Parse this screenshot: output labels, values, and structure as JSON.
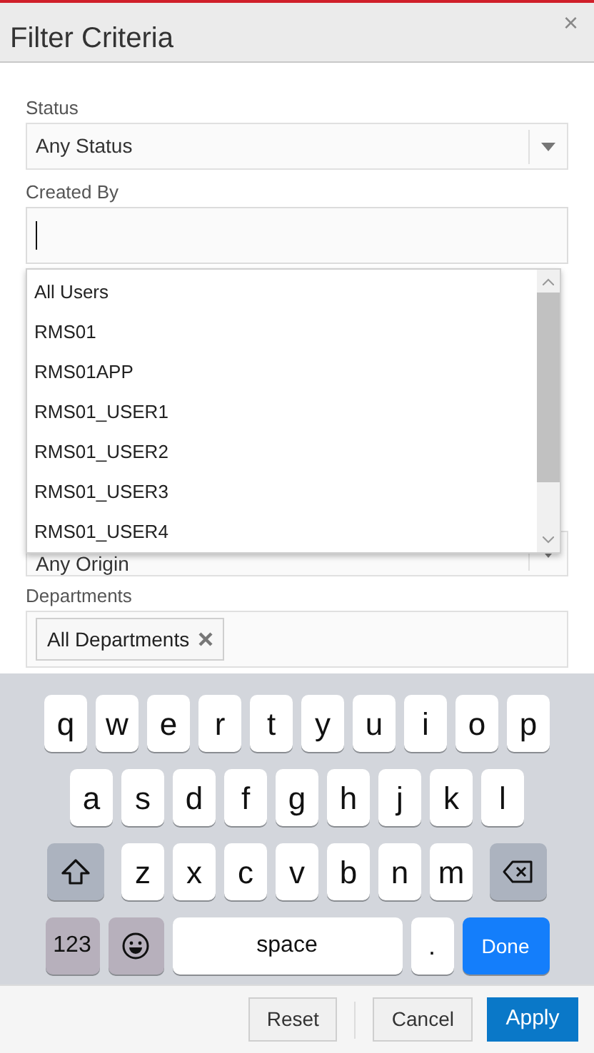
{
  "dialog": {
    "title": "Filter Criteria",
    "close": "×"
  },
  "fields": [
    {
      "kind": "select",
      "label": "Status",
      "value": "Any Status"
    },
    {
      "kind": "text",
      "label": "Created By",
      "focused": true
    },
    {
      "kind": "select",
      "value": "Any Origin"
    },
    {
      "kind": "chips",
      "label": "Departments",
      "chips": [
        "All Departments"
      ]
    }
  ],
  "dropdown": {
    "items": [
      "All Users",
      "RMS01",
      "RMS01APP",
      "RMS01_USER1",
      "RMS01_USER2",
      "RMS01_USER3",
      "RMS01_USER4"
    ]
  },
  "keyboard": {
    "rows": [
      {
        "keys": [
          {
            "kind": "letter",
            "label": "q"
          },
          {
            "kind": "letter",
            "label": "w"
          },
          {
            "kind": "letter",
            "label": "e"
          },
          {
            "kind": "letter",
            "label": "r"
          },
          {
            "kind": "letter",
            "label": "t"
          },
          {
            "kind": "letter",
            "label": "y"
          },
          {
            "kind": "letter",
            "label": "u"
          },
          {
            "kind": "letter",
            "label": "i"
          },
          {
            "kind": "letter",
            "label": "o"
          },
          {
            "kind": "letter",
            "label": "p"
          }
        ]
      },
      {
        "keys": [
          {
            "kind": "letter",
            "label": "a"
          },
          {
            "kind": "letter",
            "label": "s"
          },
          {
            "kind": "letter",
            "label": "d"
          },
          {
            "kind": "letter",
            "label": "f"
          },
          {
            "kind": "letter",
            "label": "g"
          },
          {
            "kind": "letter",
            "label": "h"
          },
          {
            "kind": "letter",
            "label": "j"
          },
          {
            "kind": "letter",
            "label": "k"
          },
          {
            "kind": "letter",
            "label": "l"
          }
        ]
      },
      {
        "keys": [
          {
            "kind": "shift"
          },
          {
            "kind": "letter",
            "label": "z"
          },
          {
            "kind": "letter",
            "label": "x"
          },
          {
            "kind": "letter",
            "label": "c"
          },
          {
            "kind": "letter",
            "label": "v"
          },
          {
            "kind": "letter",
            "label": "b"
          },
          {
            "kind": "letter",
            "label": "n"
          },
          {
            "kind": "letter",
            "label": "m"
          },
          {
            "kind": "backspace"
          }
        ]
      },
      {
        "keys": [
          {
            "kind": "numbers",
            "label": "123"
          },
          {
            "kind": "emoji"
          },
          {
            "kind": "space",
            "label": "space"
          },
          {
            "kind": "period",
            "label": "."
          },
          {
            "kind": "done",
            "label": "Done"
          }
        ]
      }
    ]
  },
  "footer": {
    "buttons": [
      {
        "label": "Reset",
        "kind": "secondary"
      },
      {
        "label": "Cancel",
        "kind": "secondary"
      },
      {
        "label": "Apply",
        "kind": "primary"
      }
    ]
  }
}
